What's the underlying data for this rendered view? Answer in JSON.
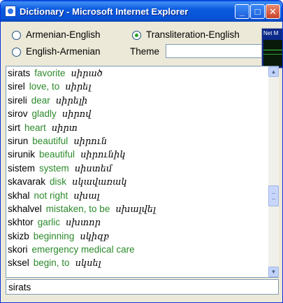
{
  "window": {
    "title": "Dictionary - Microsoft Internet Explorer",
    "minimize_glyph": "_",
    "maximize_glyph": "□",
    "close_glyph": "✕"
  },
  "modes": {
    "armenian_english": "Armenian-English",
    "english_armenian": "English-Armenian",
    "transliteration_english": "Transliteration-English",
    "selected": "transliteration_english"
  },
  "theme": {
    "label": "Theme",
    "value": ""
  },
  "netmeter": {
    "title": "Net M"
  },
  "entries": [
    {
      "tr": "sirats",
      "en": "favorite",
      "arm": "սիրած"
    },
    {
      "tr": "sirel",
      "en": "love, to",
      "arm": "սիրել"
    },
    {
      "tr": "sireli",
      "en": "dear",
      "arm": "սիրելի"
    },
    {
      "tr": "sirov",
      "en": "gladly",
      "arm": "սիրով"
    },
    {
      "tr": "sirt",
      "en": "heart",
      "arm": "սիրտ"
    },
    {
      "tr": "sirun",
      "en": "beautiful",
      "arm": "սիրուն"
    },
    {
      "tr": "sirunik",
      "en": "beautiful",
      "arm": "սիրունիկ"
    },
    {
      "tr": "sistem",
      "en": "system",
      "arm": "սիստեմ"
    },
    {
      "tr": "skavarak",
      "en": "disk",
      "arm": "սկավառակ"
    },
    {
      "tr": "skhal",
      "en": "not right",
      "arm": "սխալ"
    },
    {
      "tr": "skhalvel",
      "en": "mistaken, to be",
      "arm": "սխալվել"
    },
    {
      "tr": "skhtor",
      "en": "garlic",
      "arm": "սխտոր"
    },
    {
      "tr": "skizb",
      "en": "beginning",
      "arm": "սկիզբ"
    },
    {
      "tr": "skori",
      "en": "emergency medical care",
      "arm": ""
    },
    {
      "tr": "sksel",
      "en": "begin, to",
      "arm": "սկսել"
    }
  ],
  "scrollbar": {
    "up_glyph": "▲",
    "down_glyph": "▼"
  },
  "search": {
    "value": "sirats"
  }
}
